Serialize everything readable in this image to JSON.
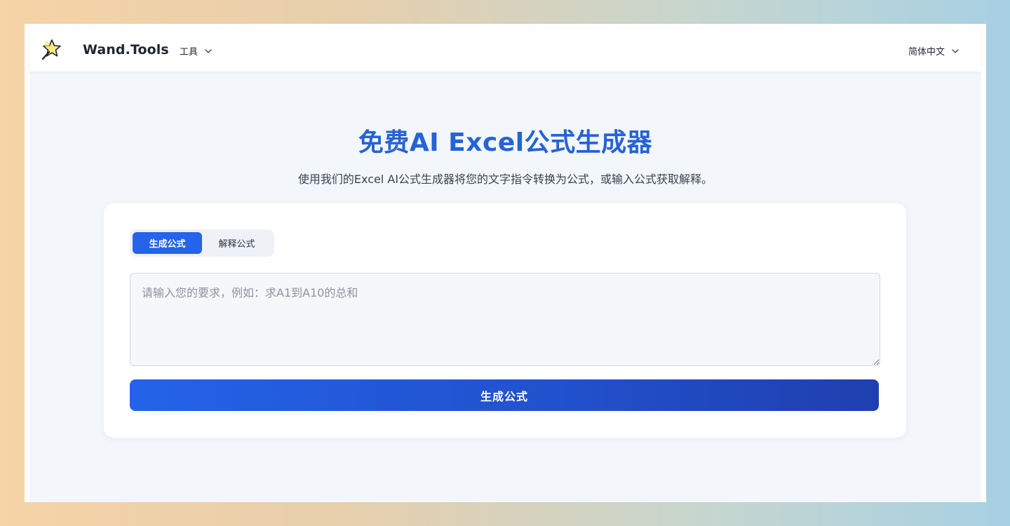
{
  "header": {
    "brand": "Wand.Tools",
    "tools_menu": "工具",
    "language": "简体中文",
    "logo_icon": "magic-wand-star-icon"
  },
  "hero": {
    "title": "免费AI Excel公式生成器",
    "subtitle": "使用我们的Excel AI公式生成器将您的文字指令转换为公式，或输入公式获取解释。"
  },
  "tabs": [
    {
      "label": "生成公式",
      "active": true
    },
    {
      "label": "解释公式",
      "active": false
    }
  ],
  "input": {
    "value": "",
    "placeholder": "请输入您的要求，例如：求A1到A10的总和"
  },
  "submit": {
    "label": "生成公式"
  },
  "colors": {
    "accent": "#2563eb",
    "title": "#2563d6",
    "page_bg": "#f3f6fa"
  }
}
